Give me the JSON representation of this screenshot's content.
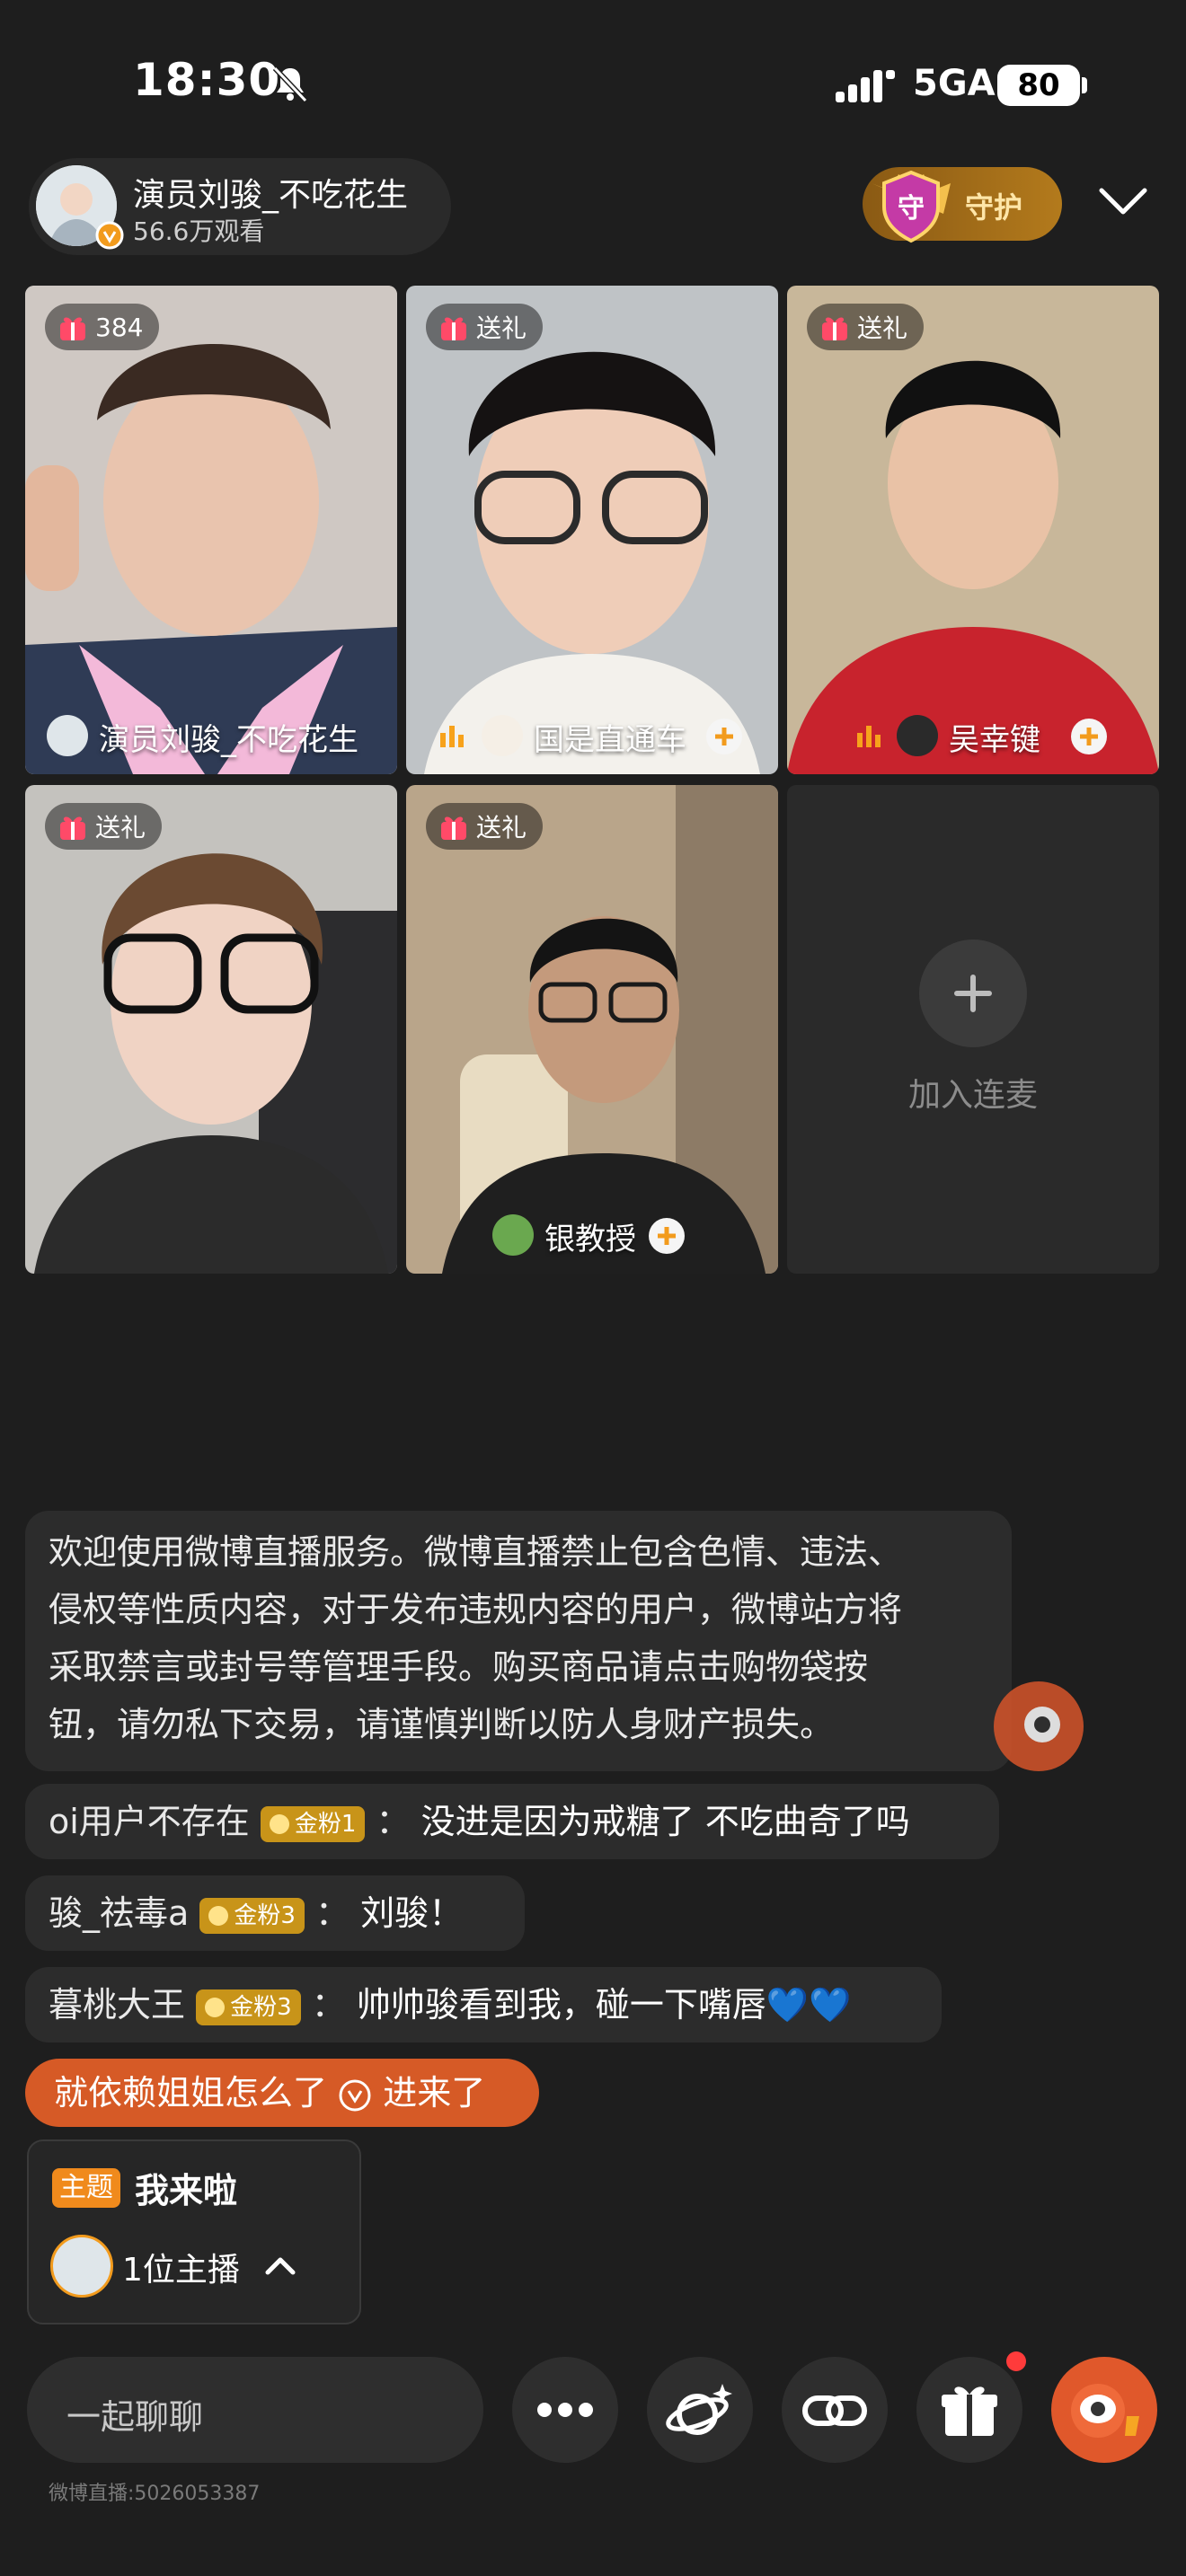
{
  "status_bar": {
    "time": "18:30",
    "network": "5GA",
    "battery": "80"
  },
  "host": {
    "name": "演员刘骏_不吃花生",
    "viewers": "56.6万观看"
  },
  "guard_label": "守护",
  "tiles": [
    {
      "badge": "384",
      "name": "演员刘骏_不吃花生"
    },
    {
      "badge": "送礼",
      "name": "国是直通车"
    },
    {
      "badge": "送礼",
      "name": "吴幸键"
    },
    {
      "badge": "送礼",
      "name": ""
    },
    {
      "badge": "送礼",
      "name": "银教授"
    }
  ],
  "join_label": "加入连麦",
  "notice": [
    "欢迎使用微博直播服务。微博直播禁止包含色情、违法、",
    "侵权等性质内容，对于发布违规内容的用户，微博站方将",
    "采取禁言或封号等管理手段。购买商品请点击购物袋按",
    "钮，请勿私下交易，请谨慎判断以防人身财产损失。"
  ],
  "comments": [
    {
      "user": "oi用户不存在",
      "badge": "金粉1",
      "text": "没进是因为戒糖了 不吃曲奇了吗"
    },
    {
      "user": "骏_祛毒a",
      "badge": "金粉3",
      "text": "刘骏！"
    },
    {
      "user": "暮桃大王",
      "badge": "金粉3",
      "text": "帅帅骏看到我，碰一下嘴唇💙💙"
    }
  ],
  "entry": {
    "user": "就依赖姐姐怎么了",
    "text": "进来了"
  },
  "topic": {
    "tag": "主题",
    "title": "我来啦",
    "hosts": "1位主播"
  },
  "input_placeholder": "一起聊聊",
  "room_id": "微博直播:5026053387",
  "colors": {
    "background": "#1e1e1e",
    "accent": "#e0582b",
    "badge_gold": "#c89419"
  }
}
